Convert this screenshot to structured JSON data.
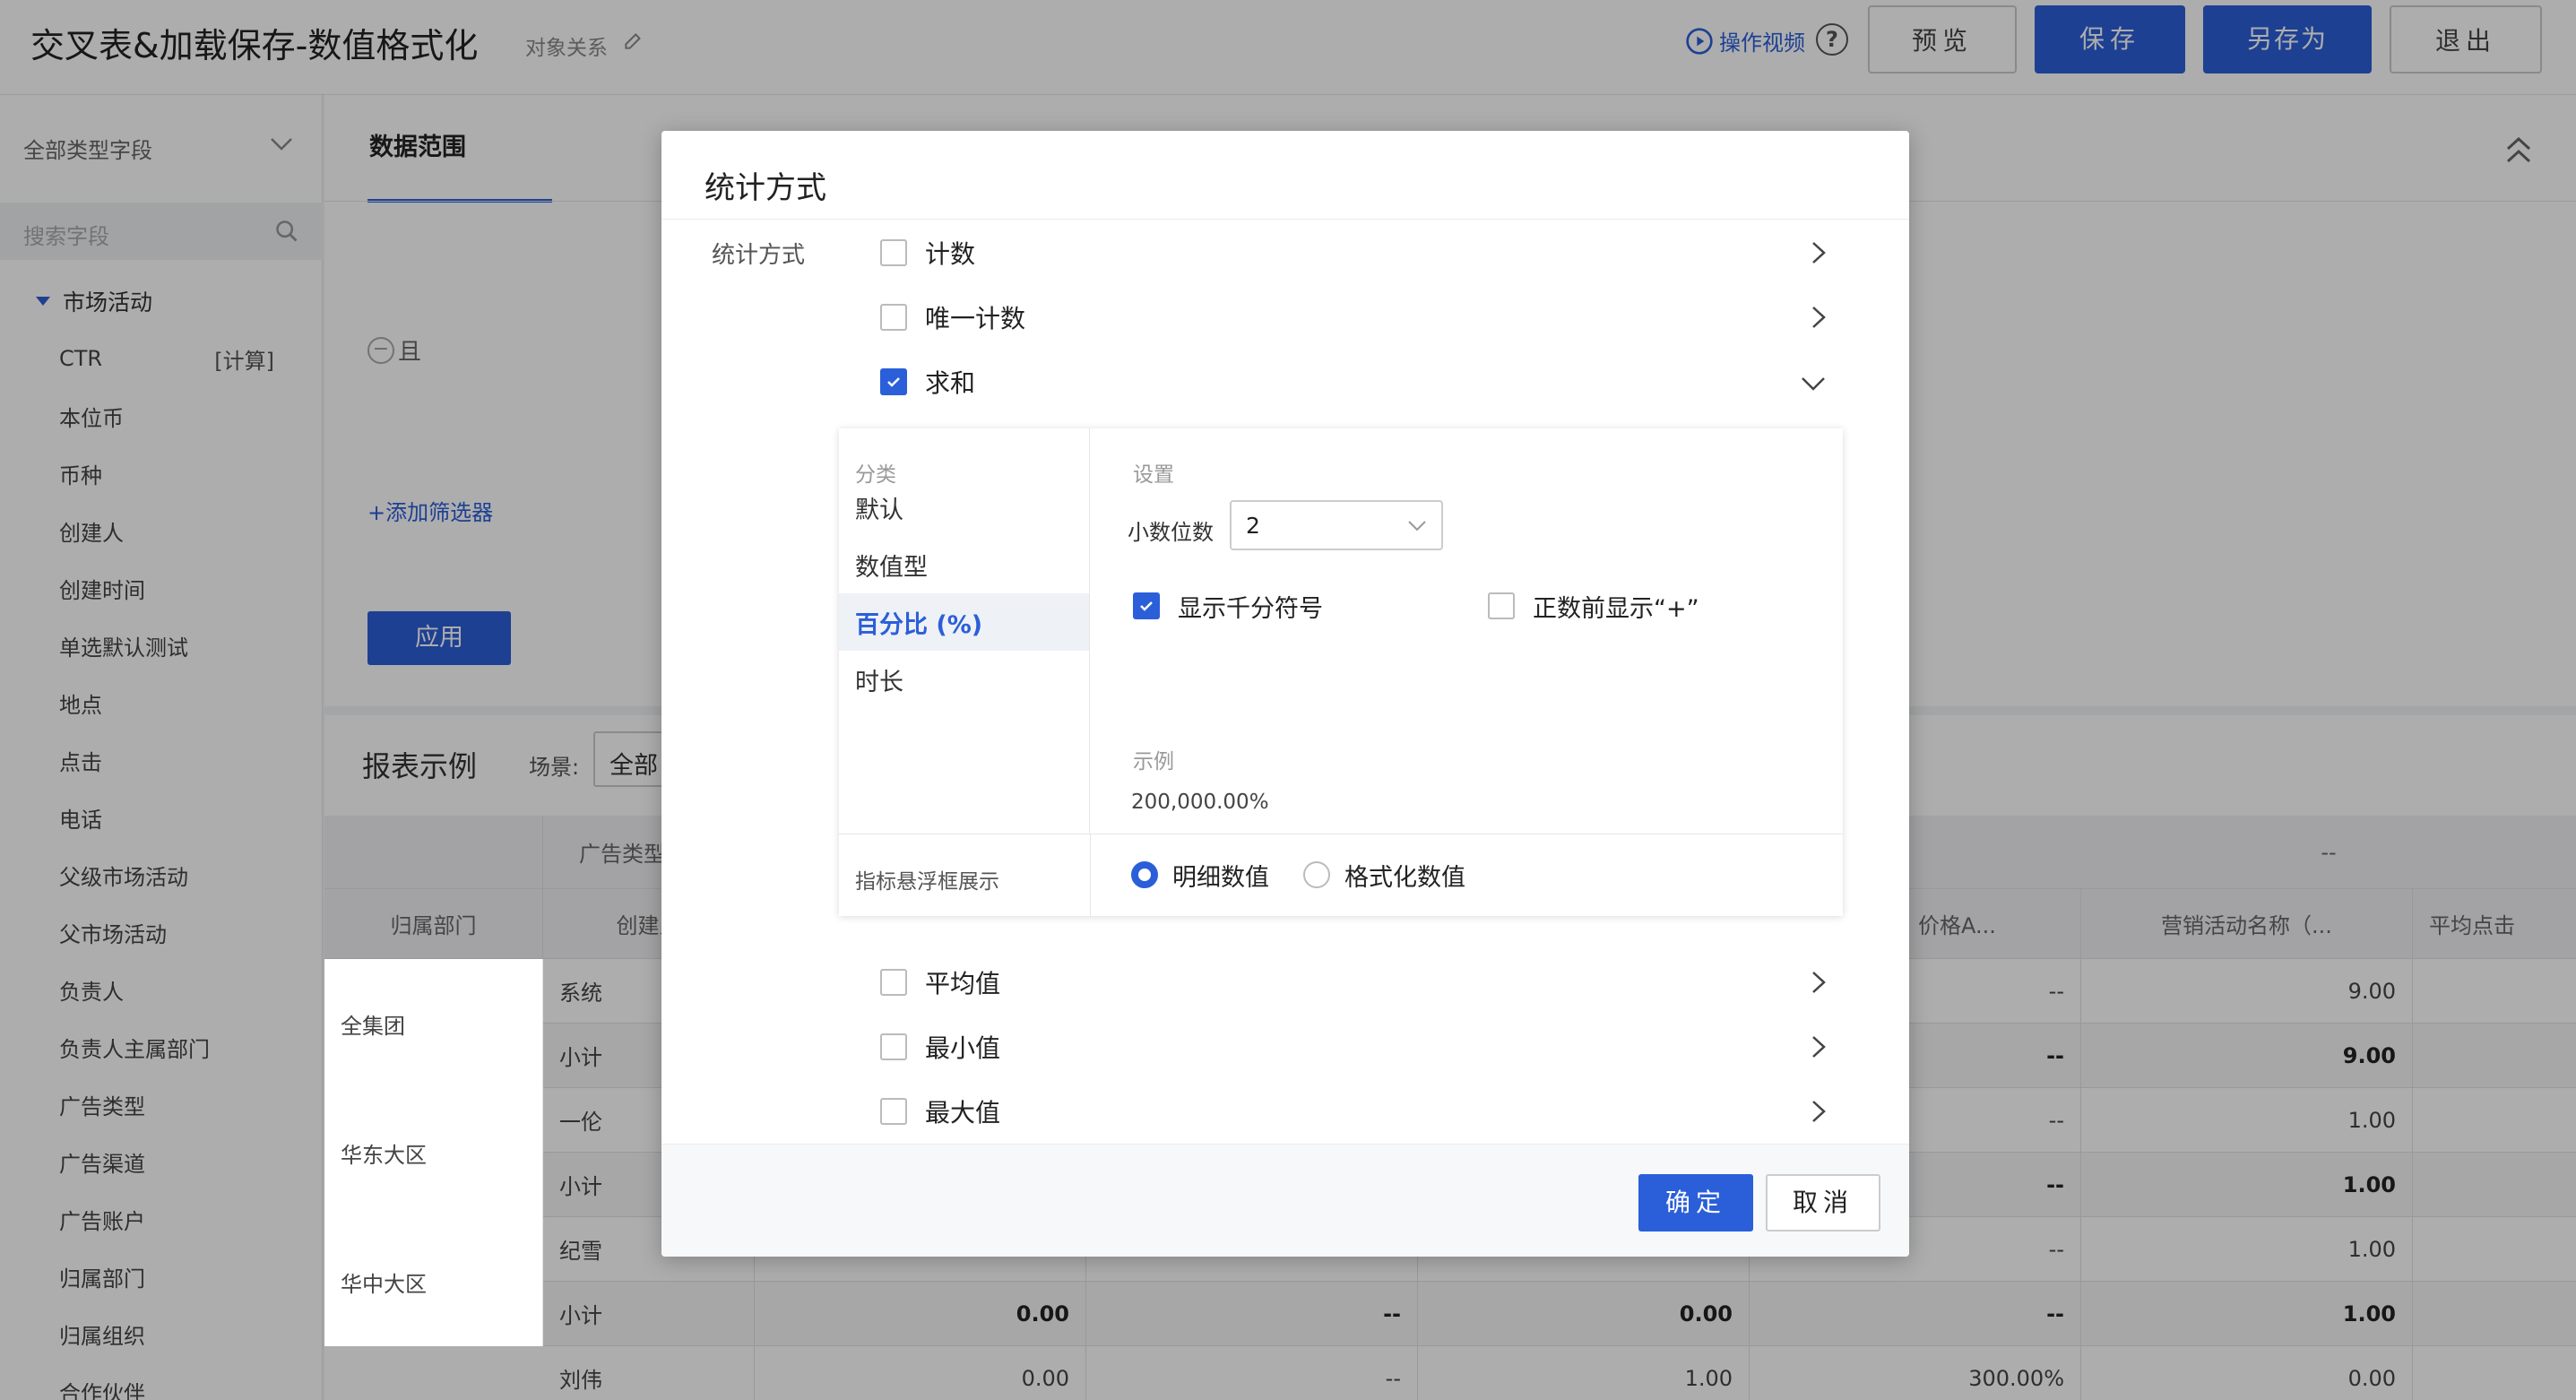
{
  "header": {
    "title": "交叉表&加载保存-数值格式化",
    "subtitle": "对象关系",
    "help_video": "操作视频",
    "help_q": "?",
    "preview": "预览",
    "save": "保存",
    "save_as": "另存为",
    "exit": "退出"
  },
  "sidebar": {
    "field_type": "全部类型字段",
    "search_placeholder": "搜索字段",
    "group": "市场活动",
    "items": [
      {
        "label": "CTR",
        "tag": "[计算]"
      },
      {
        "label": "本位币"
      },
      {
        "label": "币种"
      },
      {
        "label": "创建人"
      },
      {
        "label": "创建时间"
      },
      {
        "label": "单选默认测试"
      },
      {
        "label": "地点"
      },
      {
        "label": "点击"
      },
      {
        "label": "电话"
      },
      {
        "label": "父级市场活动"
      },
      {
        "label": "父市场活动"
      },
      {
        "label": "负责人"
      },
      {
        "label": "负责人主属部门"
      },
      {
        "label": "广告类型"
      },
      {
        "label": "广告渠道"
      },
      {
        "label": "广告账户"
      },
      {
        "label": "归属部门"
      },
      {
        "label": "归属组织"
      },
      {
        "label": "合作伙伴"
      }
    ]
  },
  "main": {
    "tab_data_range": "数据范围",
    "and_label": "且",
    "add_filter": "+添加筛选器",
    "apply": "应用",
    "report_title": "报表示例",
    "scene_label": "场景:",
    "scene_value": "全部",
    "table": {
      "group_header": "广告类型",
      "dash_header": "--",
      "col_dept": "归属部门",
      "col_creator": "创建人",
      "col_price": "价格A...",
      "col_campaign": "营销活动名称（...",
      "col_avg_click": "平均点击",
      "rows": [
        {
          "dept": "全集团",
          "creator": "系统",
          "c1": "",
          "c2": "",
          "c3": "",
          "c4": "--",
          "c5": "9.00",
          "sub": false
        },
        {
          "dept": "",
          "creator": "小计",
          "c1": "",
          "c2": "",
          "c3": "",
          "c4": "--",
          "c5": "9.00",
          "sub": true
        },
        {
          "dept": "华东大区",
          "creator": "一伦",
          "c1": "",
          "c2": "",
          "c3": "",
          "c4": "--",
          "c5": "1.00",
          "sub": false
        },
        {
          "dept": "",
          "creator": "小计",
          "c1": "",
          "c2": "",
          "c3": "",
          "c4": "--",
          "c5": "1.00",
          "sub": true
        },
        {
          "dept": "华中大区",
          "creator": "纪雪",
          "c1": "",
          "c2": "",
          "c3": "",
          "c4": "--",
          "c5": "1.00",
          "sub": false
        },
        {
          "dept": "",
          "creator": "小计",
          "c1": "0.00",
          "c2": "--",
          "c3": "0.00",
          "c4": "--",
          "c5": "1.00",
          "sub": true
        },
        {
          "dept": "",
          "creator": "刘伟",
          "c1": "0.00",
          "c2": "--",
          "c3": "1.00",
          "c4": "300.00%",
          "c5": "0.00",
          "sub": false
        }
      ]
    }
  },
  "modal": {
    "title": "统计方式",
    "stat_label": "统计方式",
    "options_top": [
      {
        "label": "计数",
        "checked": false
      },
      {
        "label": "唯一计数",
        "checked": false
      },
      {
        "label": "求和",
        "checked": true
      }
    ],
    "options_bottom": [
      {
        "label": "平均值",
        "checked": false
      },
      {
        "label": "最小值",
        "checked": false
      },
      {
        "label": "最大值",
        "checked": false
      }
    ],
    "format": {
      "category_caption": "分类",
      "categories": [
        "默认",
        "数值型",
        "百分比 (%)",
        "时长"
      ],
      "active_category": "百分比 (%)",
      "settings_caption": "设置",
      "decimal_label": "小数位数",
      "decimal_value": "2",
      "thousand_sep_label": "显示千分符号",
      "thousand_sep_checked": true,
      "plus_sign_label": "正数前显示“+”",
      "plus_sign_checked": false,
      "example_caption": "示例",
      "example_value": "200,000.00%",
      "tooltip_label": "指标悬浮框展示",
      "tooltip_detail": "明细数值",
      "tooltip_formatted": "格式化数值",
      "tooltip_selected": "明细数值"
    },
    "ok": "确定",
    "cancel": "取消"
  },
  "colors": {
    "accent": "#2b5fd9",
    "overlay": "rgba(0,0,0,0.32)"
  }
}
